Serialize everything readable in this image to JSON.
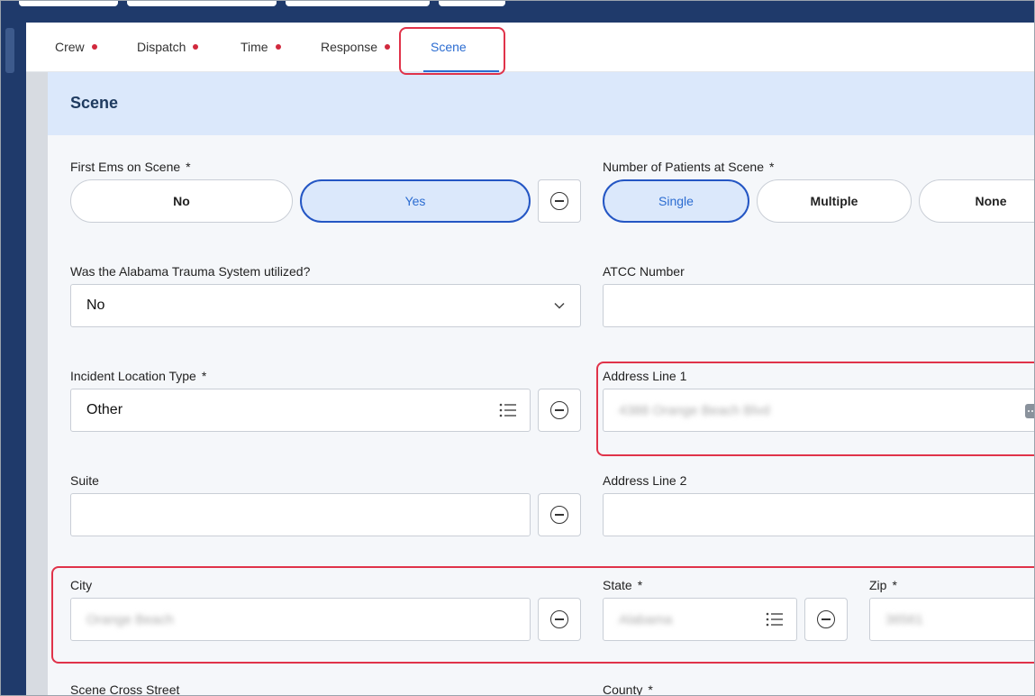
{
  "tabs": [
    {
      "label": "Crew",
      "has_alert": true
    },
    {
      "label": "Dispatch",
      "has_alert": true
    },
    {
      "label": "Time",
      "has_alert": true
    },
    {
      "label": "Response",
      "has_alert": true
    },
    {
      "label": "Scene",
      "active": true
    }
  ],
  "section": {
    "title": "Scene"
  },
  "fields": {
    "first_ems": {
      "label": "First Ems on Scene",
      "required": "*",
      "options": [
        "No",
        "Yes"
      ],
      "selected": "Yes"
    },
    "num_patients": {
      "label": "Number of Patients at Scene",
      "required": "*",
      "options": [
        "Single",
        "Multiple",
        "None"
      ],
      "selected": "Single"
    },
    "trauma_system": {
      "label": "Was the Alabama Trauma System utilized?",
      "value": "No"
    },
    "atcc_number": {
      "label": "ATCC Number",
      "value": ""
    },
    "incident_location_type": {
      "label": "Incident Location Type",
      "required": "*",
      "value": "Other"
    },
    "address_line1": {
      "label": "Address Line 1",
      "value": "4388 Orange Beach Blvd"
    },
    "suite": {
      "label": "Suite",
      "value": ""
    },
    "address_line2": {
      "label": "Address Line 2",
      "value": ""
    },
    "city": {
      "label": "City",
      "value": "Orange Beach"
    },
    "state": {
      "label": "State",
      "required": "*",
      "value": "Alabama"
    },
    "zip": {
      "label": "Zip",
      "required": "*",
      "value": "36561"
    },
    "scene_cross_street": {
      "label": "Scene Cross Street"
    },
    "county": {
      "label": "County",
      "required": "*"
    }
  },
  "colors": {
    "accent": "#2b6cd1",
    "alert": "#d1293d",
    "highlight": "#e0334a",
    "nav": "#1f3a6b"
  }
}
